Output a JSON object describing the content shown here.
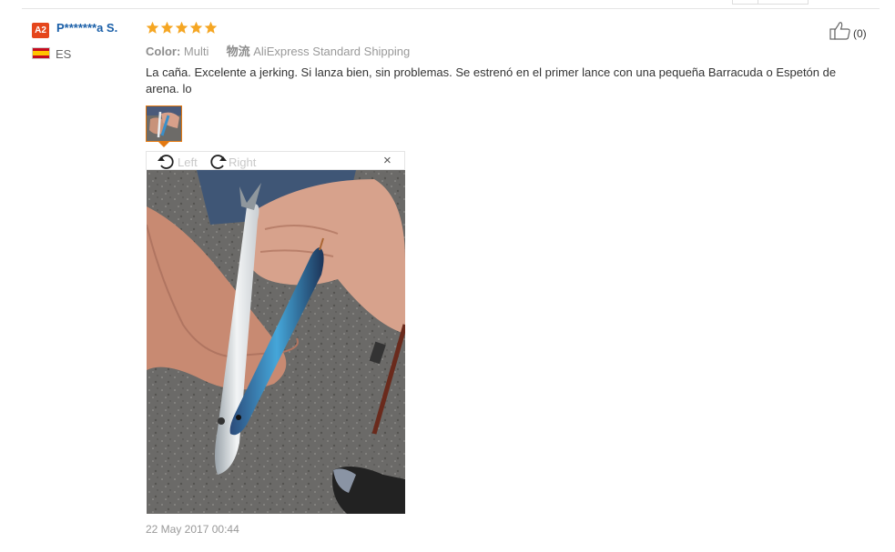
{
  "reviewer": {
    "badge": "A2",
    "name": "P*******a S.",
    "country": "ES"
  },
  "rating": {
    "stars": 5,
    "max": 5,
    "color": "#f5a623"
  },
  "meta": {
    "color_label": "Color:",
    "color_value": "Multi",
    "shipping_label": "物流",
    "shipping_value": "AliExpress Standard Shipping"
  },
  "helpful": {
    "count": "(0)",
    "icon": "thumbs-up-icon"
  },
  "review_text": "La caña. Excelente a jerking. Si lanza bien, sin problemas. Se estrenó en el primer lance con una pequeña Barracuda o Espetón de arena. lo",
  "viewer": {
    "rotate_left": "Left",
    "rotate_right": "Right",
    "close": "×"
  },
  "date": "22 May 2017 00:44",
  "colors": {
    "accent": "#e47911",
    "link": "#1a5fa8",
    "badge": "#e5461c"
  }
}
